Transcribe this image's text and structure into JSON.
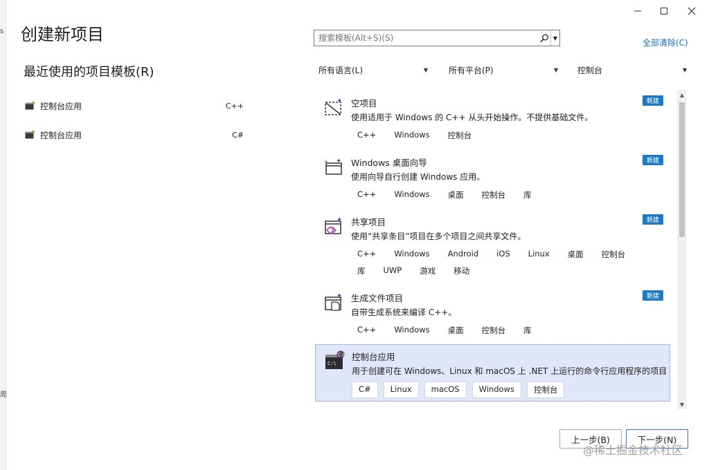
{
  "edge": {
    "top_glyph": "s",
    "bottom_glyph": "周"
  },
  "window_controls": {
    "minimize": "—",
    "maximize": "☐",
    "close": "✕"
  },
  "dialog": {
    "title": "创建新项目"
  },
  "recent": {
    "title": "最近使用的项目模板(R)",
    "items": [
      {
        "name": "控制台应用",
        "lang": "C++",
        "icon": "console-app-icon"
      },
      {
        "name": "控制台应用",
        "lang": "C#",
        "icon": "console-app-icon"
      }
    ]
  },
  "search": {
    "placeholder": "搜索模板(Alt+S)(S)",
    "value": ""
  },
  "clear_all": "全部清除(C)",
  "filters": [
    {
      "label": "所有语言(L)"
    },
    {
      "label": "所有平台(P)"
    },
    {
      "label": "控制台"
    }
  ],
  "templates": [
    {
      "name": "空项目",
      "desc": "使用适用于 Windows 的 C++ 从头开始操作。不提供基础文件。",
      "badge": "新建",
      "icon": "empty-project-icon",
      "tag_rows": [
        [
          "C++",
          "Windows",
          "控制台"
        ]
      ]
    },
    {
      "name": "Windows 桌面向导",
      "desc": "使用向导自行创建 Windows 应用。",
      "badge": "新建",
      "icon": "desktop-wizard-icon",
      "tag_rows": [
        [
          "C++",
          "Windows",
          "桌面",
          "控制台",
          "库"
        ]
      ]
    },
    {
      "name": "共享项目",
      "desc": "使用“共享条目”项目在多个项目之间共享文件。",
      "badge": "新建",
      "icon": "shared-project-icon",
      "tag_rows": [
        [
          "C++",
          "Windows",
          "Android",
          "iOS",
          "Linux",
          "桌面",
          "控制台"
        ],
        [
          "库",
          "UWP",
          "游戏",
          "移动"
        ]
      ]
    },
    {
      "name": "生成文件项目",
      "desc": "自带生成系统来编译 C++。",
      "badge": "新建",
      "icon": "makefile-project-icon",
      "tag_rows": [
        [
          "C++",
          "Windows",
          "桌面",
          "控制台",
          "库"
        ]
      ]
    },
    {
      "name": "控制台应用",
      "desc": "用于创建可在 Windows、Linux 和 macOS 上 .NET 上运行的命令行应用程序的项目",
      "badge": "",
      "icon": "csharp-console-icon",
      "tag_rows": [
        [
          "C#",
          "Linux",
          "macOS",
          "Windows",
          "控制台"
        ]
      ],
      "selected": true
    }
  ],
  "buttons": {
    "back": "上一步(B)",
    "next": "下一步(N)"
  },
  "watermark": "@稀土掘金技术社区",
  "colors": {
    "accent": "#1f7ac6",
    "link": "#1a6fb8",
    "selected_bg": "#dfe7f8"
  }
}
